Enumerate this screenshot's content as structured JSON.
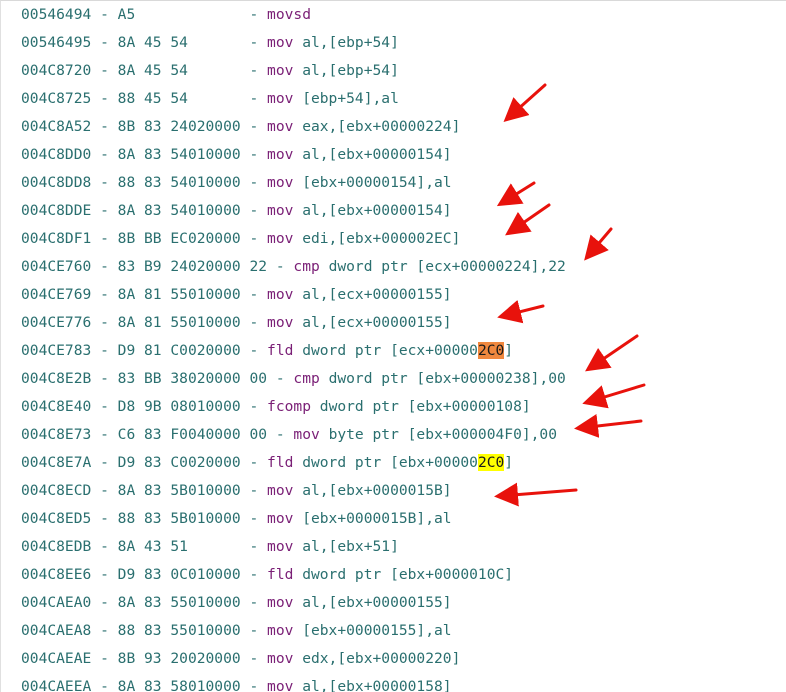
{
  "lines": [
    {
      "addr": "00546494",
      "bytes": "A5",
      "imm": "",
      "instr": "movsd",
      "op_pre": "",
      "op_hl": "",
      "op_post": ""
    },
    {
      "addr": "00546495",
      "bytes": "8A 45 54",
      "imm": "",
      "instr": "mov",
      "op_pre": "al,[ebp+54]",
      "op_hl": "",
      "op_post": ""
    },
    {
      "addr": "004C8720",
      "bytes": "8A 45 54",
      "imm": "",
      "instr": "mov",
      "op_pre": "al,[ebp+54]",
      "op_hl": "",
      "op_post": ""
    },
    {
      "addr": "004C8725",
      "bytes": "88 45 54",
      "imm": "",
      "instr": "mov",
      "op_pre": "[ebp+54],al",
      "op_hl": "",
      "op_post": ""
    },
    {
      "addr": "004C8A52",
      "bytes": "8B 83 24020000",
      "imm": "",
      "instr": "mov",
      "op_pre": "eax,[ebx+00000224]",
      "op_hl": "",
      "op_post": ""
    },
    {
      "addr": "004C8DD0",
      "bytes": "8A 83 54010000",
      "imm": "",
      "instr": "mov",
      "op_pre": "al,[ebx+00000154]",
      "op_hl": "",
      "op_post": ""
    },
    {
      "addr": "004C8DD8",
      "bytes": "88 83 54010000",
      "imm": "",
      "instr": "mov",
      "op_pre": "[ebx+00000154],al",
      "op_hl": "",
      "op_post": ""
    },
    {
      "addr": "004C8DDE",
      "bytes": "8A 83 54010000",
      "imm": "",
      "instr": "mov",
      "op_pre": "al,[ebx+00000154]",
      "op_hl": "",
      "op_post": ""
    },
    {
      "addr": "004C8DF1",
      "bytes": "8B BB EC020000",
      "imm": "",
      "instr": "mov",
      "op_pre": "edi,[ebx+000002EC]",
      "op_hl": "",
      "op_post": ""
    },
    {
      "addr": "004CE760",
      "bytes": "83 B9 24020000 22",
      "imm": "",
      "instr": "cmp",
      "op_pre": "dword ptr [ecx+00000224],22",
      "op_hl": "",
      "op_post": ""
    },
    {
      "addr": "004CE769",
      "bytes": "8A 81 55010000",
      "imm": "",
      "instr": "mov",
      "op_pre": "al,[ecx+00000155]",
      "op_hl": "",
      "op_post": ""
    },
    {
      "addr": "004CE776",
      "bytes": "8A 81 55010000",
      "imm": "",
      "instr": "mov",
      "op_pre": "al,[ecx+00000155]",
      "op_hl": "",
      "op_post": ""
    },
    {
      "addr": "004CE783",
      "bytes": "D9 81 C0020000",
      "imm": "",
      "instr": "fld",
      "op_pre": "dword ptr [ecx+00000",
      "op_hl": "2C0",
      "op_post": "]",
      "hl": "orange"
    },
    {
      "addr": "004C8E2B",
      "bytes": "83 BB 38020000 00",
      "imm": "",
      "instr": "cmp",
      "op_pre": "dword ptr [ebx+00000238],00",
      "op_hl": "",
      "op_post": ""
    },
    {
      "addr": "004C8E40",
      "bytes": "D8 9B 08010000",
      "imm": "",
      "instr": "fcomp",
      "op_pre": "dword ptr [ebx+00000108]",
      "op_hl": "",
      "op_post": ""
    },
    {
      "addr": "004C8E73",
      "bytes": "C6 83 F0040000 00",
      "imm": "",
      "instr": "mov",
      "op_pre": "byte ptr [ebx+000004F0],00",
      "op_hl": "",
      "op_post": ""
    },
    {
      "addr": "004C8E7A",
      "bytes": "D9 83 C0020000",
      "imm": "",
      "instr": "fld",
      "op_pre": "dword ptr [ebx+00000",
      "op_hl": "2C0",
      "op_post": "]",
      "hl": "yellow"
    },
    {
      "addr": "004C8ECD",
      "bytes": "8A 83 5B010000",
      "imm": "",
      "instr": "mov",
      "op_pre": "al,[ebx+0000015B]",
      "op_hl": "",
      "op_post": ""
    },
    {
      "addr": "004C8ED5",
      "bytes": "88 83 5B010000",
      "imm": "",
      "instr": "mov",
      "op_pre": "[ebx+0000015B],al",
      "op_hl": "",
      "op_post": ""
    },
    {
      "addr": "004C8EDB",
      "bytes": "8A 43 51",
      "imm": "",
      "instr": "mov",
      "op_pre": "al,[ebx+51]",
      "op_hl": "",
      "op_post": ""
    },
    {
      "addr": "004C8EE6",
      "bytes": "D9 83 0C010000",
      "imm": "",
      "instr": "fld",
      "op_pre": "dword ptr [ebx+0000010C]",
      "op_hl": "",
      "op_post": ""
    },
    {
      "addr": "004CAEA0",
      "bytes": "8A 83 55010000",
      "imm": "",
      "instr": "mov",
      "op_pre": "al,[ebx+00000155]",
      "op_hl": "",
      "op_post": ""
    },
    {
      "addr": "004CAEA8",
      "bytes": "88 83 55010000",
      "imm": "",
      "instr": "mov",
      "op_pre": "[ebx+00000155],al",
      "op_hl": "",
      "op_post": ""
    },
    {
      "addr": "004CAEAE",
      "bytes": "8B 93 20020000",
      "imm": "",
      "instr": "mov",
      "op_pre": "edx,[ebx+00000220]",
      "op_hl": "",
      "op_post": ""
    },
    {
      "addr": "004CAEEA",
      "bytes": "8A 83 58010000",
      "imm": "",
      "instr": "mov",
      "op_pre": "al,[ebx+00000158]",
      "op_hl": "",
      "op_post": ""
    }
  ],
  "colors": {
    "arrow": "#e8120c",
    "highlight_orange": "#f0883e",
    "highlight_yellow": "#ffff00"
  }
}
